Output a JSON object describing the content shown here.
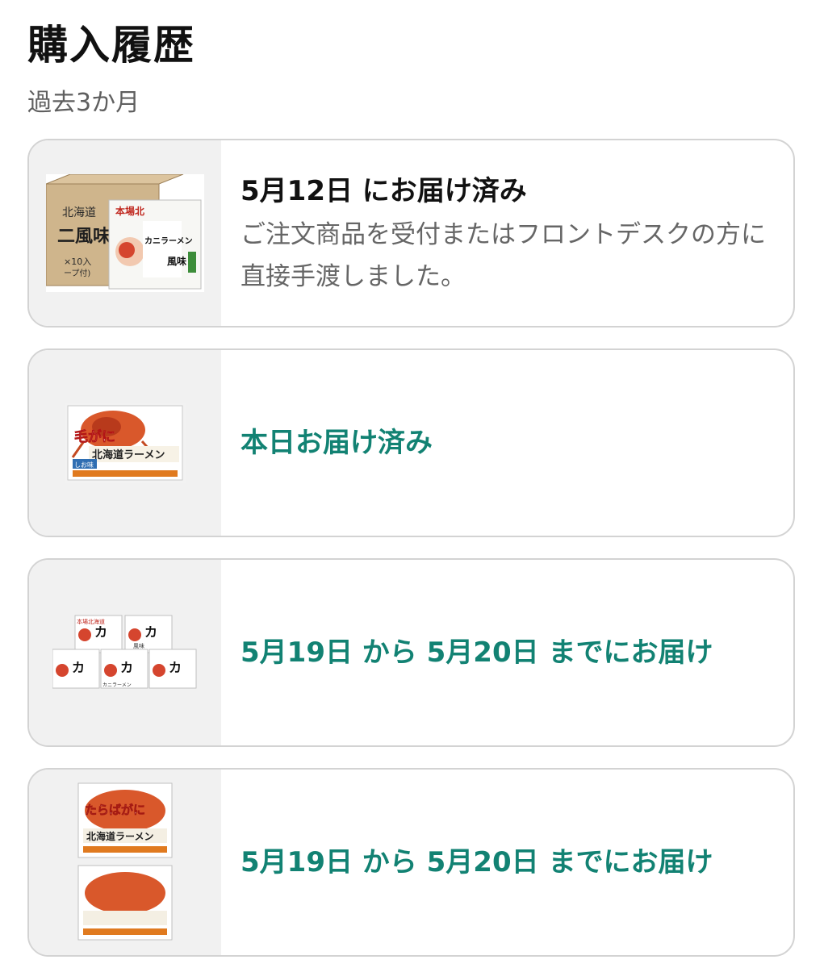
{
  "header": {
    "title": "購入履歴",
    "subtitle": "過去3か月"
  },
  "orders": [
    {
      "status": "5月12日 にお届け済み",
      "description": "ご注文商品を受付またはフロントデスクの方に直接手渡しました。",
      "status_color": "#111111",
      "thumbnail": {
        "box_text_1": "北海道",
        "box_text_2": "二風味",
        "box_text_3": "×10入",
        "box_text_4": "ープ付)",
        "pack_text_1": "本場北",
        "pack_text_2": "カニラーメン",
        "pack_text_3": "風味"
      }
    },
    {
      "status": "本日お届け済み",
      "description": "",
      "status_color": "#128273",
      "thumbnail": {
        "pack_text_1": "毛がに",
        "pack_text_2": "北海道ラーメン",
        "pack_text_3": "しお味"
      }
    },
    {
      "status": "5月19日 から 5月20日 までにお届け",
      "description": "",
      "status_color": "#128273",
      "thumbnail": {
        "pack_text_1": "本場北海道",
        "pack_text_2": "カニラーメン",
        "pack_text_3": "風味"
      }
    },
    {
      "status": "5月19日 から 5月20日 までにお届け",
      "description": "",
      "status_color": "#128273",
      "thumbnail": {
        "pack_text_1": "たらばがに",
        "pack_text_2": "北海道ラーメン"
      }
    }
  ],
  "colors": {
    "accent": "#128273",
    "border": "#d3d3d3",
    "thumb_bg": "#f1f1f1"
  }
}
